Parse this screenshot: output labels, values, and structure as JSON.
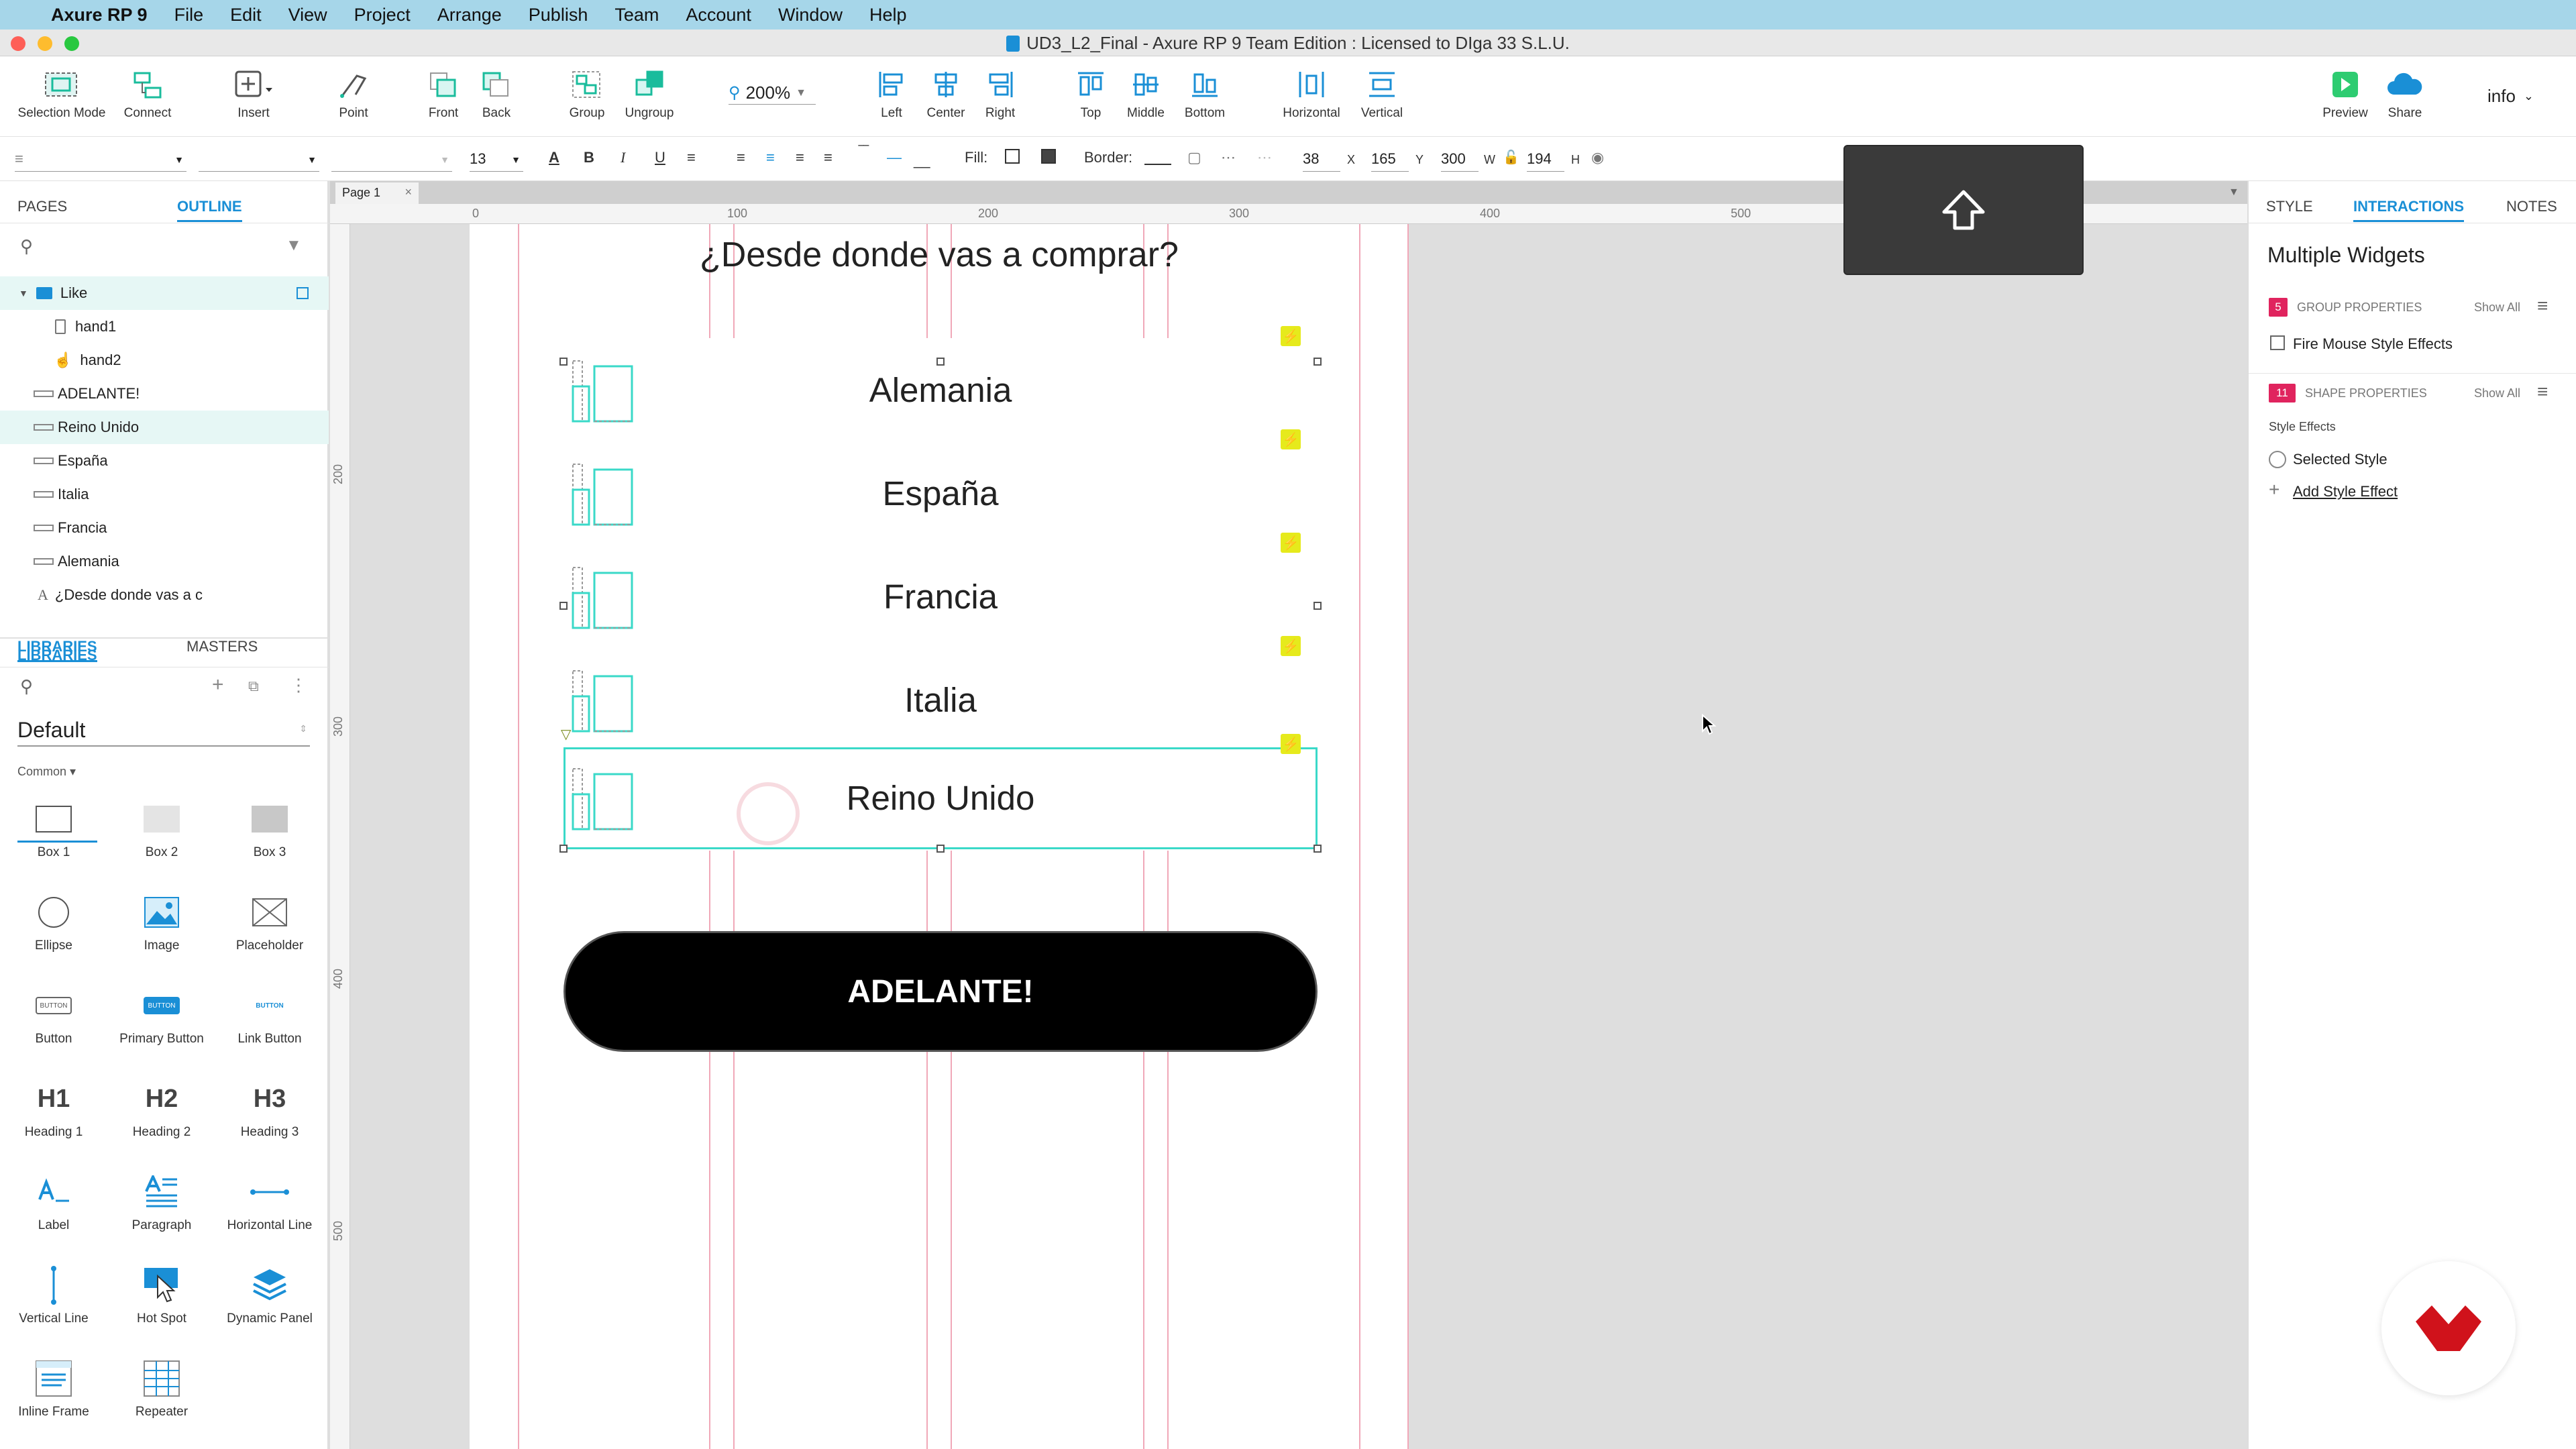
{
  "menubar": {
    "app": "Axure RP 9",
    "items": [
      "File",
      "Edit",
      "View",
      "Project",
      "Arrange",
      "Publish",
      "Team",
      "Account",
      "Window",
      "Help"
    ]
  },
  "window": {
    "title": "UD3_L2_Final - Axure RP 9 Team Edition : Licensed to DIga 33 S.L.U."
  },
  "toolbar": {
    "selection_mode": "Selection Mode",
    "connect": "Connect",
    "insert": "Insert",
    "point": "Point",
    "front": "Front",
    "back": "Back",
    "group": "Group",
    "ungroup": "Ungroup",
    "zoom": "200%",
    "left": "Left",
    "center": "Center",
    "right": "Right",
    "top": "Top",
    "middle": "Middle",
    "bottom": "Bottom",
    "horizontal": "Horizontal",
    "vertical": "Vertical",
    "preview": "Preview",
    "share": "Share",
    "account": "info"
  },
  "format": {
    "font_size": "13",
    "fill_label": "Fill:",
    "border_label": "Border:",
    "x_value": "38",
    "x_label": "X",
    "y_value": "165",
    "y_label": "Y",
    "w_value": "300",
    "w_label": "W",
    "h_value": "194",
    "h_label": "H"
  },
  "left_panel": {
    "tabs": [
      "PAGES",
      "OUTLINE"
    ],
    "active_tab": "OUTLINE",
    "outline": [
      {
        "label": "Like",
        "type": "folder",
        "selected": true
      },
      {
        "label": "hand1",
        "type": "image"
      },
      {
        "label": "hand2",
        "type": "hand"
      },
      {
        "label": "ADELANTE!",
        "type": "shape"
      },
      {
        "label": "Reino Unido",
        "type": "shape",
        "highlighted": true
      },
      {
        "label": "España",
        "type": "shape"
      },
      {
        "label": "Italia",
        "type": "shape"
      },
      {
        "label": "Francia",
        "type": "shape"
      },
      {
        "label": "Alemania",
        "type": "shape"
      },
      {
        "label": "¿Desde donde vas a c",
        "type": "text"
      }
    ],
    "lib_tabs": [
      "LIBRARIES",
      "MASTERS"
    ],
    "library_name": "Default",
    "category": "Common ▾",
    "widgets": [
      "Box 1",
      "Box 2",
      "Box 3",
      "Ellipse",
      "Image",
      "Placeholder",
      "Button",
      "Primary Button",
      "Link Button",
      "Heading 1",
      "Heading 2",
      "Heading 3",
      "Label",
      "Paragraph",
      "Horizontal Line",
      "Vertical Line",
      "Hot Spot",
      "Dynamic Panel",
      "Inline Frame",
      "Repeater"
    ],
    "widget_glyphs": {
      "h1": "H1",
      "h2": "H2",
      "h3": "H3",
      "button_text": "BUTTON"
    }
  },
  "canvas": {
    "page_tab": "Page 1",
    "ruler_marks": [
      "0",
      "100",
      "200",
      "300",
      "400",
      "500"
    ],
    "ruler_v_marks": [
      "200",
      "300",
      "400",
      "500"
    ],
    "question": "¿Desde donde vas a comprar?",
    "countries": [
      "Alemania",
      "España",
      "Francia",
      "Italia",
      "Reino Unido"
    ],
    "cta": "ADELANTE!"
  },
  "right_panel": {
    "tabs": [
      "STYLE",
      "INTERACTIONS",
      "NOTES"
    ],
    "active_tab": "INTERACTIONS",
    "title": "Multiple Widgets",
    "group_count": "5",
    "group_properties": "GROUP PROPERTIES",
    "show_all": "Show All",
    "fire_mouse": "Fire Mouse Style Effects",
    "shape_count": "11",
    "shape_properties": "SHAPE PROPERTIES",
    "style_effects": "Style Effects",
    "selected_style": "Selected Style",
    "add_style_effect": "Add Style Effect"
  },
  "colors": {
    "menubar": "#a6d6e9",
    "accent": "#1a8fd6",
    "selection": "#3ad9c8",
    "guide": "#f0a8b8",
    "cta_bg": "#000000",
    "badge": "#e0245e",
    "bolt": "#e6ea1c"
  }
}
